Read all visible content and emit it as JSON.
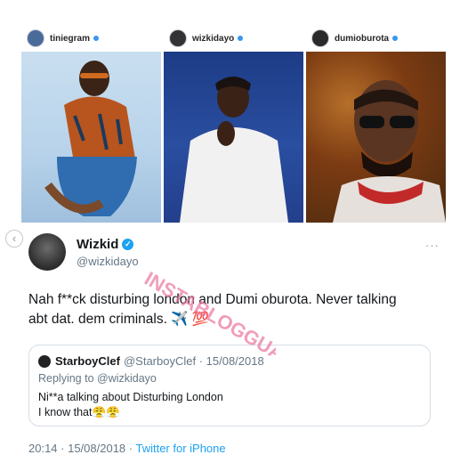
{
  "profiles": [
    {
      "username": "tiniegram"
    },
    {
      "username": "wizkidayo"
    },
    {
      "username": "dumioburota"
    }
  ],
  "tweet": {
    "display_name": "Wizkid",
    "handle": "@wizkidayo",
    "more": "···",
    "text_line1": "Nah f**ck disturbing london and Dumi oburota. Never talking",
    "text_line2": "abt dat. dem criminals. ✈️ 💯",
    "quote": {
      "name": "StarboyClef",
      "meta": "@StarboyClef · 15/08/2018",
      "reply_to": "Replying to @wizkidayo",
      "line1": "Ni**a talking about Disturbing London",
      "line2": "I know that😤😤"
    },
    "timestamp": "20:14 · 15/08/2018 · ",
    "client": "Twitter for iPhone"
  },
  "watermark": {
    "text": "INSTABLOGGUA"
  },
  "colors": {
    "verified": "#1da1f2",
    "watermark": "#e8739e"
  }
}
